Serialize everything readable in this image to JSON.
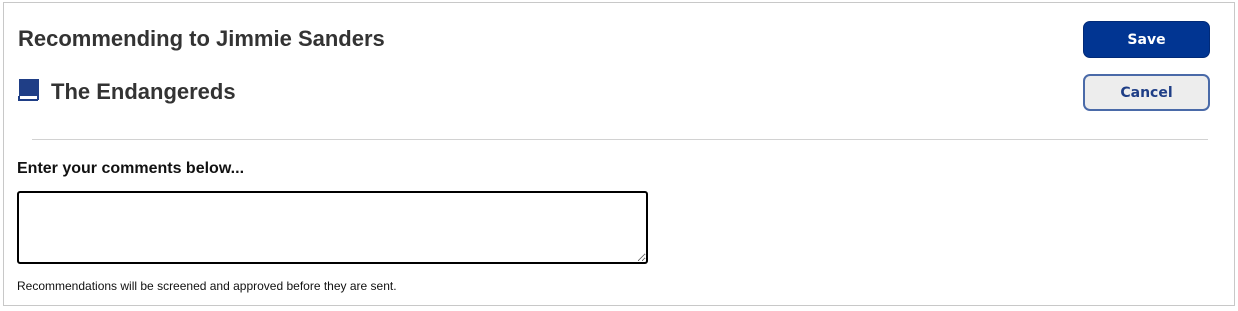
{
  "header": {
    "title": "Recommending to Jimmie Sanders",
    "book_title": "The Endangereds",
    "book_icon": "book-icon"
  },
  "actions": {
    "save_label": "Save",
    "cancel_label": "Cancel"
  },
  "comments": {
    "label": "Enter your comments below...",
    "value": "",
    "note": "Recommendations will be screened and approved before they are sent."
  },
  "colors": {
    "primary": "#013592",
    "icon": "#1f3e86",
    "text": "#333333"
  }
}
